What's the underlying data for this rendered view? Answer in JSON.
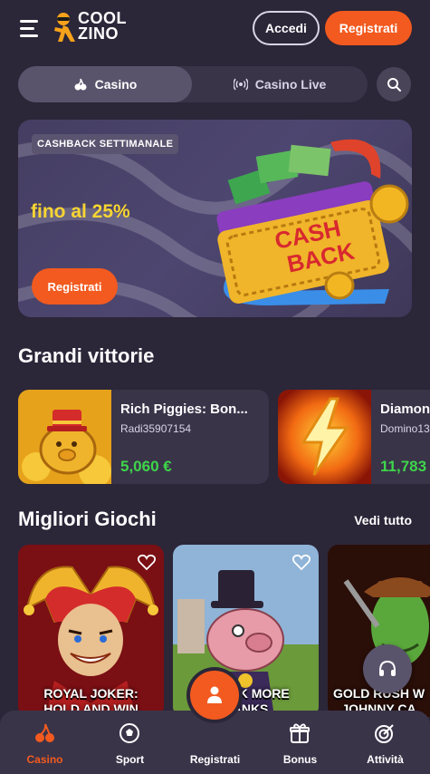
{
  "header": {
    "logo_line1": "COOL",
    "logo_line2": "ZINO",
    "login_label": "Accedi",
    "register_label": "Registrati"
  },
  "tabs": [
    {
      "label": "Casino",
      "icon": "cherries-icon",
      "active": true
    },
    {
      "label": "Casino Live",
      "icon": "live-signal-icon",
      "active": false
    }
  ],
  "banner": {
    "tag": "CASHBACK SETTIMANALE",
    "headline": "fino al 25%",
    "button_label": "Registrati",
    "art_text_1": "CASH",
    "art_text_2": "BACK"
  },
  "big_wins": {
    "title": "Grandi vittorie",
    "items": [
      {
        "game": "Rich Piggies: Bon...",
        "user": "Radi35907154",
        "amount": "5,060 €"
      },
      {
        "game": "Diamon",
        "user": "Domino13",
        "amount": "11,783"
      }
    ]
  },
  "top_games": {
    "title": "Migliori Giochi",
    "see_all": "Vedi tutto",
    "items": [
      {
        "name_line1": "ROYAL JOKER:",
        "name_line2": "HOLD AND WIN"
      },
      {
        "name_line1": "CRACK MORE",
        "name_line2": "BANKS"
      },
      {
        "name_line1": "GOLD RUSH W",
        "name_line2": "JOHNNY CA"
      }
    ]
  },
  "bottom_nav": [
    {
      "label": "Casino",
      "icon": "cherries-icon",
      "active": true
    },
    {
      "label": "Sport",
      "icon": "soccer-ball-icon",
      "active": false
    },
    {
      "label": "Registrati",
      "icon": "user-icon",
      "active": false
    },
    {
      "label": "Bonus",
      "icon": "gift-icon",
      "active": false
    },
    {
      "label": "Attività",
      "icon": "target-icon",
      "active": false
    }
  ],
  "colors": {
    "background": "#2b2638",
    "accent": "#f25a1f",
    "win_green": "#3ed64b",
    "banner_yellow": "#f7d532"
  }
}
